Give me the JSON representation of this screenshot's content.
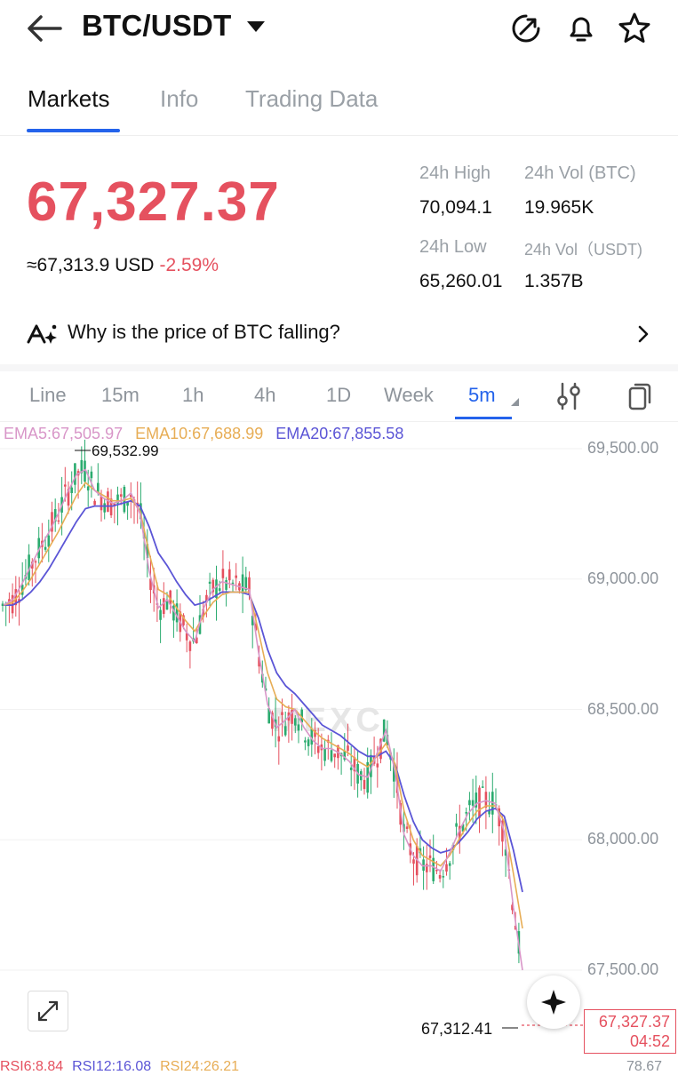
{
  "header": {
    "title": "BTC/USDT"
  },
  "tabs": [
    {
      "label": "Markets",
      "active": true
    },
    {
      "label": "Info",
      "active": false
    },
    {
      "label": "Trading Data",
      "active": false
    }
  ],
  "ticker": {
    "price": "67,327.37",
    "usd_equiv": "≈67,313.9 USD",
    "change": "-2.59%",
    "high_label": "24h High",
    "high_value": "70,094.1",
    "vol_btc_label": "24h Vol (BTC)",
    "vol_btc_value": "19.965K",
    "low_label": "24h Low",
    "low_value": "65,260.01",
    "vol_usdt_label": "24h Vol（USDT)",
    "vol_usdt_value": "1.357B"
  },
  "insight": {
    "text": "Why is the price of BTC falling?"
  },
  "intervals": [
    {
      "label": "Line",
      "active": false
    },
    {
      "label": "15m",
      "active": false
    },
    {
      "label": "1h",
      "active": false
    },
    {
      "label": "4h",
      "active": false
    },
    {
      "label": "1D",
      "active": false
    },
    {
      "label": "Week",
      "active": false
    },
    {
      "label": "5m",
      "active": true
    }
  ],
  "indicators": {
    "ema5": "EMA5:67,505.97",
    "ema10": "EMA10:67,688.99",
    "ema20": "EMA20:67,855.58"
  },
  "chart_extra": {
    "max_label": "69,532.99",
    "min_label": "67,312.41",
    "last_price": "67,327.37",
    "countdown": "04:52",
    "watermark": "MEXC"
  },
  "rsi": {
    "r1": "RSI6:8.84",
    "r2": "RSI12:16.08",
    "r3": "RSI24:26.21",
    "side": "78.67"
  },
  "colors": {
    "up": "#2bab6f",
    "down": "#e5515f",
    "ema5": "#d896c8",
    "ema10": "#e7ad55",
    "ema20": "#5b55d6",
    "accent": "#2463eb"
  },
  "chart_data": {
    "type": "candlestick",
    "ylabels": [
      "69,500.00",
      "69,000.00",
      "68,500.00",
      "68,000.00",
      "67,500.00"
    ],
    "yticks": [
      69500,
      69000,
      68500,
      68000,
      67500
    ],
    "ylim": [
      67300,
      69560
    ],
    "ema5": [
      68900,
      68920,
      68980,
      69050,
      69120,
      69180,
      69250,
      69330,
      69400,
      69420,
      69340,
      69310,
      69290,
      69300,
      69330,
      69250,
      69030,
      68890,
      68920,
      68860,
      68800,
      68760,
      68890,
      68960,
      68990,
      68980,
      68970,
      68960,
      68720,
      68520,
      68430,
      68460,
      68500,
      68430,
      68380,
      68350,
      68350,
      68330,
      68300,
      68250,
      68240,
      68330,
      68420,
      68260,
      68020,
      67940,
      67900,
      67900,
      67880,
      67950,
      68030,
      68100,
      68140,
      68150,
      68140,
      68030,
      67740,
      67500
    ],
    "ema10": [
      68900,
      68910,
      68950,
      69000,
      69060,
      69120,
      69180,
      69250,
      69320,
      69370,
      69340,
      69320,
      69300,
      69300,
      69310,
      69260,
      69100,
      68960,
      68940,
      68890,
      68840,
      68800,
      68860,
      68910,
      68940,
      68950,
      68950,
      68950,
      68800,
      68640,
      68540,
      68510,
      68500,
      68460,
      68420,
      68390,
      68370,
      68350,
      68330,
      68300,
      68280,
      68320,
      68370,
      68290,
      68110,
      68000,
      67940,
      67920,
      67900,
      67940,
      68000,
      68060,
      68110,
      68130,
      68130,
      68070,
      67870,
      67660
    ],
    "ema20": [
      68900,
      68900,
      68920,
      68950,
      68990,
      69040,
      69100,
      69160,
      69220,
      69270,
      69280,
      69280,
      69280,
      69290,
      69300,
      69280,
      69200,
      69100,
      69050,
      68990,
      68940,
      68900,
      68910,
      68930,
      68950,
      68950,
      68950,
      68940,
      68850,
      68730,
      68640,
      68590,
      68560,
      68520,
      68480,
      68440,
      68420,
      68400,
      68370,
      68340,
      68320,
      68320,
      68340,
      68290,
      68170,
      68070,
      68000,
      67970,
      67950,
      67960,
      67990,
      68030,
      68080,
      68110,
      68120,
      68090,
      67960,
      67800
    ]
  }
}
